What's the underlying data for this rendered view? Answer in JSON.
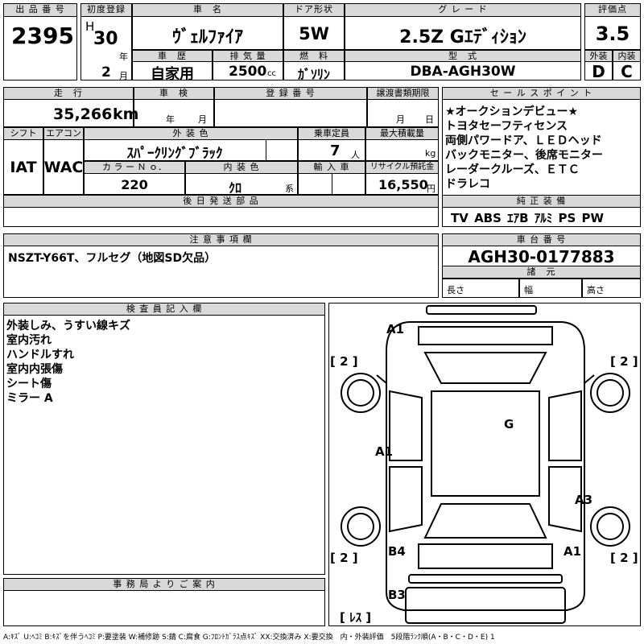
{
  "header": {
    "lot_label": "出 品 番 号",
    "lot": "2395",
    "first_reg_label": "初度登録",
    "era": "H",
    "year": "30",
    "year_unit": "年",
    "month": "2",
    "month_unit": "月",
    "car_name_label": "車　名",
    "car_name": "ｳﾞｪﾙﾌｧｲｱ",
    "door_label": "ドア形状",
    "door": "5W",
    "grade_label": "グ レ ー ド",
    "grade": "2.5Z Gｴﾃﾞｨｼｮﾝ",
    "score_label": "評価点",
    "score": "3.5",
    "history_label": "車　歴",
    "history": "自家用",
    "displacement_label": "排 気 量",
    "displacement": "2500",
    "displacement_unit": "cc",
    "fuel_label": "燃　料",
    "fuel": "ｶﾞｿﾘﾝ",
    "model_label": "型　式",
    "model": "DBA-AGH30W",
    "exterior_label": "外装",
    "exterior": "D",
    "interior_label": "内装",
    "interior": "C"
  },
  "row2": {
    "mileage_label": "走　行",
    "mileage": "35,266",
    "mileage_unit": "km",
    "inspection_label": "車　検",
    "inspection_year_unit": "年",
    "inspection_month_unit": "月",
    "reg_no_label": "登 録 番 号",
    "transfer_label": "譲渡書類期限",
    "transfer_month_unit": "月",
    "transfer_day_unit": "日",
    "shift_label": "シフト",
    "shift": "IAT",
    "ac_label": "エアコン",
    "ac": "WAC",
    "color_label": "外 装 色",
    "color": "ｽﾊﾟｰｸﾘﾝｸﾞﾌﾞﾗｯｸ",
    "capacity_label": "乗車定員",
    "capacity": "7",
    "capacity_unit": "人",
    "load_label": "最大積載量",
    "load_unit": "kg",
    "color_no_label": "カ ラ ー Ｎ ｏ．",
    "color_no": "220",
    "int_color_label": "内 装 色",
    "int_color": "ｸﾛ",
    "int_color_unit": "系",
    "import_label": "輸 入 車",
    "recycle_label": "リサイクル預託金",
    "recycle": "16,550",
    "recycle_unit": "円",
    "later_parts_label": "後 日 発 送 部 品"
  },
  "sales": {
    "label": "セ ー ル ス ポ イ ン ト",
    "lines": [
      "★オークションデビュー★",
      "トヨタセーフティセンス",
      "両側パワードア、ＬＥＤヘッド",
      "バックモニター、後席モニター",
      "レーダークルーズ、ＥＴＣ",
      "ドラレコ"
    ],
    "equip_label": "純 正 装 備",
    "equip": "TV ABS ｴｱB ｱﾙﾐ PS PW"
  },
  "notes": {
    "label": "注 意 事 項 欄",
    "text": "NSZT-Y66T、フルセグ（地図SD欠品）"
  },
  "chassis": {
    "label": "車 台 番 号",
    "number": "AGH30-0177883",
    "spec_label": "諸　元",
    "length_label": "長さ",
    "width_label": "幅",
    "height_label": "高さ"
  },
  "inspector": {
    "label": "検 査 員 記 入 欄",
    "lines": [
      "外装しみ、うすい線キズ",
      "室内汚れ",
      "ハンドルすれ",
      "室内内張傷",
      "シート傷",
      "ミラー A"
    ]
  },
  "office": {
    "label": "事 務 局 よ り ご 案 内"
  },
  "diagram": {
    "marks": [
      "A1",
      "[ 2 ]",
      "[ 2 ]",
      "G",
      "A1",
      "A3",
      "[ 2 ]",
      "[ 2 ]",
      "B4",
      "A1",
      "B3",
      "[ ﾚｽ ]"
    ]
  },
  "legend": "A:ｷｽﾞ U:ﾍｺﾐ B:ｷｽﾞを伴うﾍｺﾐ P:要塗装 W:補修跡 S:錆 C:腐食 G:ﾌﾛﾝﾄｶﾞﾗｽ点ｷｽﾞ XX:交換済み X:要交換　内・外装評価　5段階ﾗﾝｸ順(A・B・C・D・E) 1"
}
